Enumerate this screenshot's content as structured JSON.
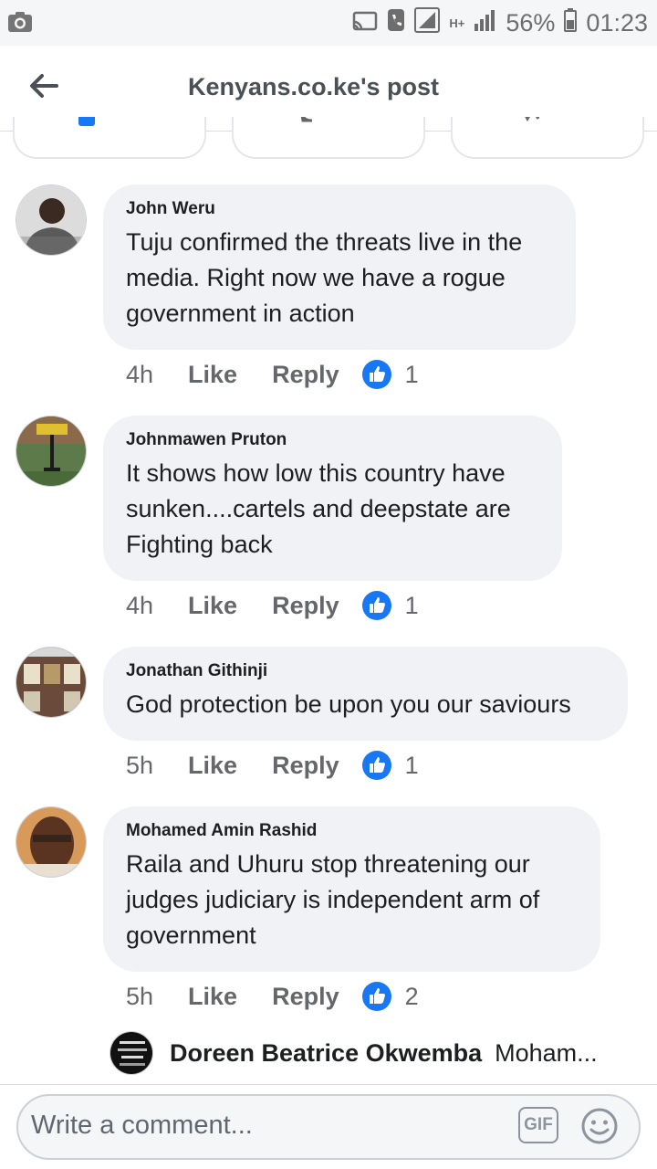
{
  "status_bar": {
    "battery": "56%",
    "time": "01:23",
    "network": "H+"
  },
  "header": {
    "title": "Kenyans.co.ke's post"
  },
  "comments": [
    {
      "author": "John Weru",
      "text": "Tuju confirmed the threats live in the\nmedia. Right now we have a rogue\ngovernment in action",
      "time": "4h",
      "like_label": "Like",
      "reply_label": "Reply",
      "reactions": "1"
    },
    {
      "author": "Johnmawen Pruton",
      "text": "It shows how low this country have\nsunken....cartels and deepstate are\nFighting back",
      "time": "4h",
      "like_label": "Like",
      "reply_label": "Reply",
      "reactions": "1"
    },
    {
      "author": "Jonathan Githinji",
      "text": "God protection be upon you our saviours",
      "time": "5h",
      "like_label": "Like",
      "reply_label": "Reply",
      "reactions": "1"
    },
    {
      "author": "Mohamed Amin Rashid",
      "text": "Raila and Uhuru stop threatening our\njudges  judiciary is independent arm of\ngovernment",
      "time": "5h",
      "like_label": "Like",
      "reply_label": "Reply",
      "reactions": "2"
    }
  ],
  "reply_preview": {
    "author": "Doreen Beatrice Okwemba",
    "snippet": "Moham..."
  },
  "composer": {
    "placeholder": "Write a comment...",
    "gif_label": "GIF"
  },
  "colors": {
    "like_blue": "#1877f2",
    "bubble_bg": "#f0f2f5"
  }
}
